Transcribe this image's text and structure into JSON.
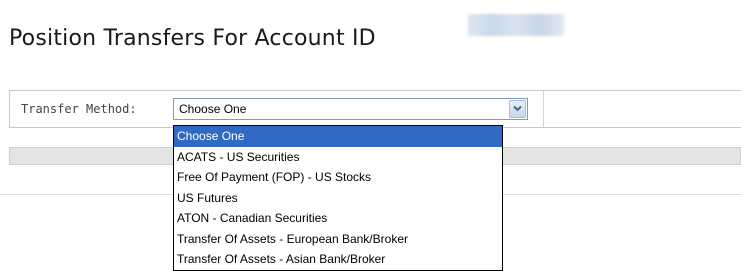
{
  "page": {
    "title": "Position Transfers For Account ID"
  },
  "transfer": {
    "label": "Transfer Method:",
    "selected_value": "Choose One",
    "options": [
      "Choose One",
      "ACATS - US Securities",
      "Free Of Payment (FOP) - US Stocks",
      "US Futures",
      "ATON - Canadian Securities",
      "Transfer Of Assets - European Bank/Broker",
      "Transfer Of Assets - Asian Bank/Broker"
    ],
    "highlighted_index": 0
  },
  "colors": {
    "highlight": "#316ac5",
    "select_border": "#7f9db9"
  },
  "icons": {
    "dropdown": "chevron-down-icon"
  }
}
